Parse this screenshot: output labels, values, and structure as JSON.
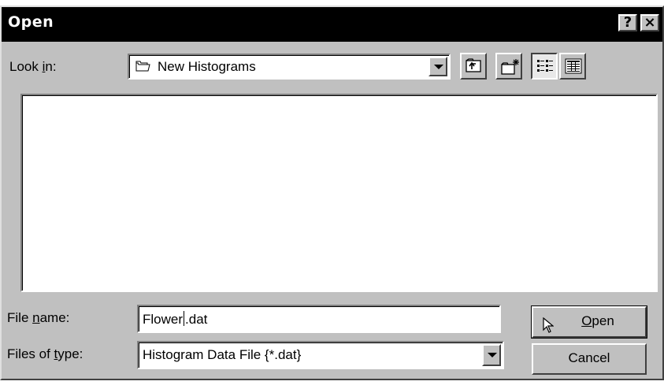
{
  "window": {
    "title": "Open",
    "help_glyph": "?",
    "close_glyph": "×"
  },
  "look_in": {
    "label_pre": "Look ",
    "label_mn": "i",
    "label_post": "n:",
    "value": "New Histograms",
    "icon": "folder-icon"
  },
  "toolbar": {
    "icons": [
      "up-one-level-icon",
      "create-new-folder-icon",
      "list-view-icon",
      "details-view-icon"
    ],
    "active_view": "list-view-icon"
  },
  "file_name": {
    "label_pre": "File ",
    "label_mn": "n",
    "label_post": "ame:",
    "value_before_caret": "Flower",
    "value_after_caret": ".dat"
  },
  "files_of_type": {
    "label_pre": "Files of ",
    "label_mn": "t",
    "label_post": "ype:",
    "value": "Histogram Data File {*.dat}"
  },
  "buttons": {
    "open_mn": "O",
    "open_rest": "pen",
    "cancel": "Cancel"
  },
  "colors": {
    "dialog_face": "#c0c0c0",
    "titlebar": "#000000"
  }
}
